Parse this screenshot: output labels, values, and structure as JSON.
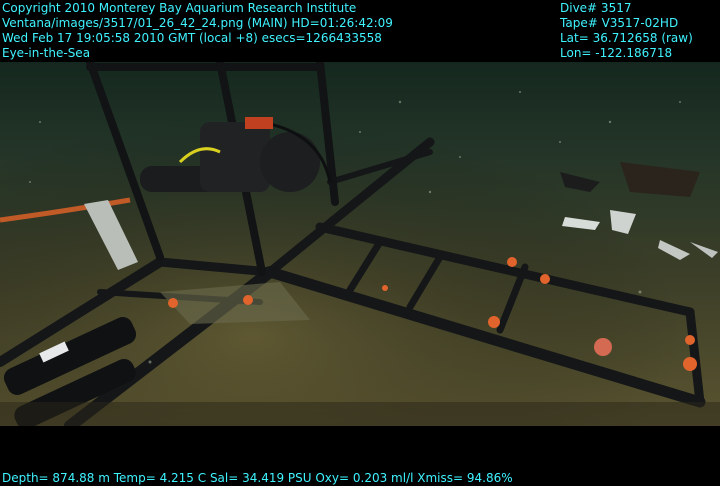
{
  "overlay": {
    "top_left": [
      "Copyright 2010 Monterey Bay Aquarium Research Institute",
      "Ventana/images/3517/01_26_42_24.png (MAIN)  HD=01:26:42:09",
      "Wed Feb 17 19:05:58 2010 GMT (local +8)  esecs=1266433558",
      "Eye-in-the-Sea"
    ],
    "top_right": [
      "Dive# 3517",
      "Tape# V3517-02HD",
      "Lat= 36.712658 (raw)",
      "Lon= -122.186718"
    ],
    "bottom": "Depth= 874.88 m  Temp= 4.215 C  Sal= 34.419 PSU  Oxy= 0.203 ml/l  Xmiss= 94.86%"
  },
  "colors": {
    "overlay_text": "#3ff3ff",
    "seafloor_near": "#4a4a2c",
    "seafloor_far": "#2b3a30",
    "water": "#13261f",
    "frame": "#16181a",
    "anemone": "#e0642c"
  }
}
